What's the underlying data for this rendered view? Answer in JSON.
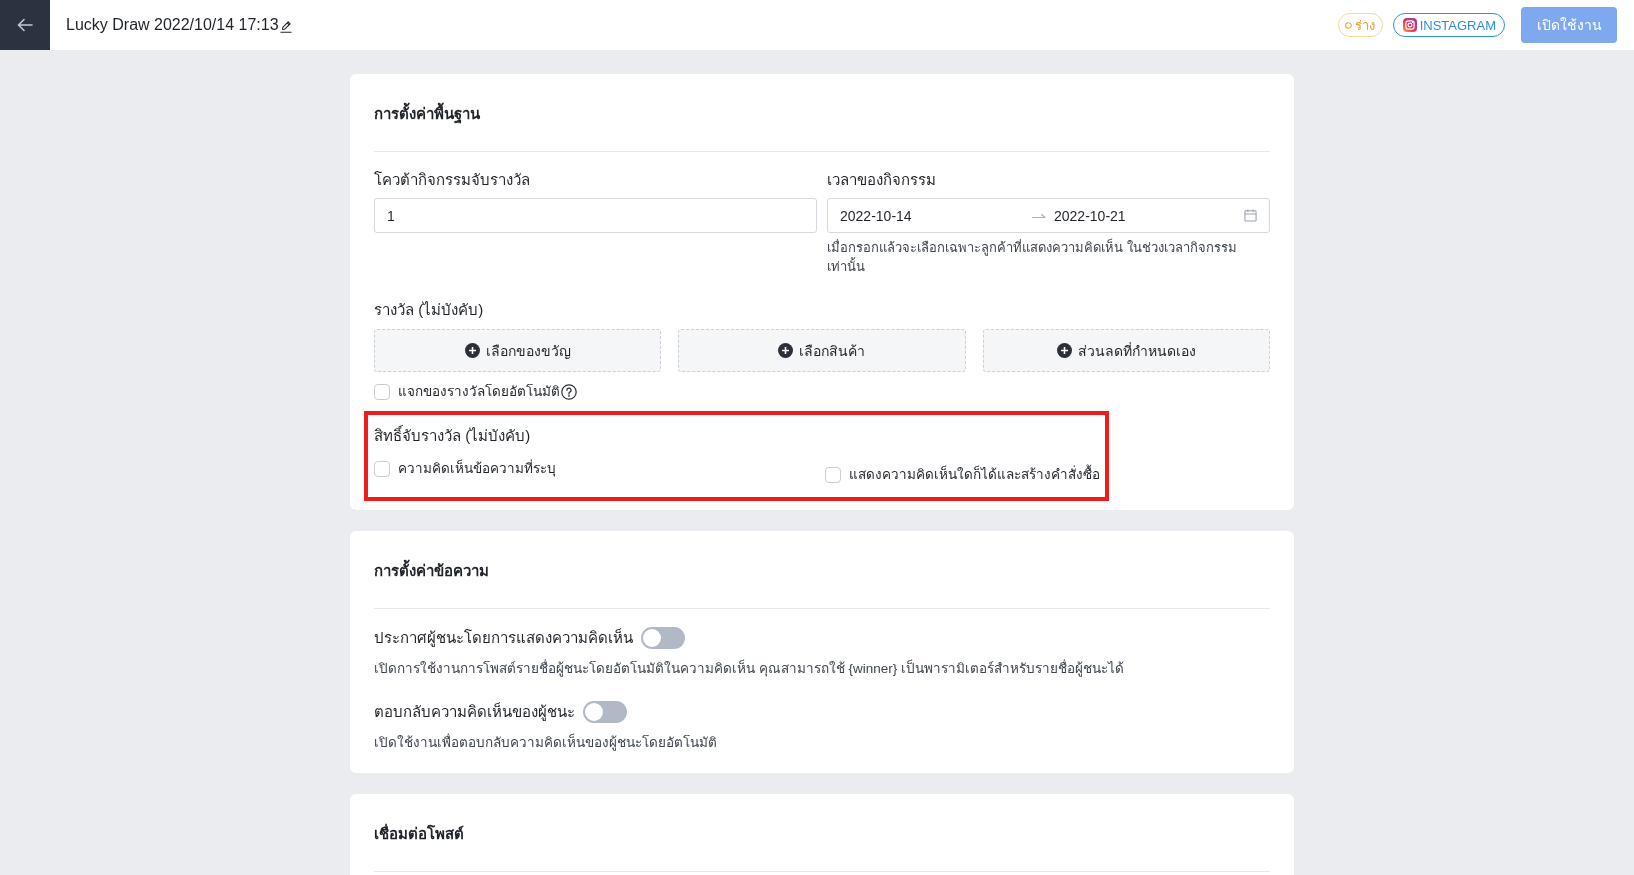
{
  "header": {
    "title": "Lucky Draw 2022/10/14 17:13",
    "status": "ร่าง",
    "platform": "INSTAGRAM",
    "enable_button": {
      "label": "เปิดใช้งาน",
      "disabled": true
    }
  },
  "basic_settings": {
    "title": "การตั้งค่าพื้นฐาน",
    "quota": {
      "label": "โควต้ากิจกรรมจับรางวัล",
      "value": "1"
    },
    "activity_time": {
      "label": "เวลาของกิจกรรม",
      "start": "2022-10-14",
      "end": "2022-10-21",
      "hint": "เมื่อกรอกแล้วจะเลือกเฉพาะลูกค้าที่แสดงความคิดเห็น ในช่วงเวลากิจกรรมเท่านั้น"
    },
    "prizes": {
      "label": "รางวัล (ไม่บังคับ)",
      "options": [
        "เลือกของขวัญ",
        "เลือกสินค้า",
        "ส่วนลดที่กำหนดเอง"
      ]
    },
    "auto_give": {
      "label": "แจกของรางวัลโดยอัตโนมัติ",
      "checked": false
    },
    "draw_rights": {
      "label": "สิทธิ์จับรางวัล (ไม่บังคับ)",
      "highlighted": true,
      "options": [
        {
          "label": "ความคิดเห็นข้อความที่ระบุ",
          "checked": false
        },
        {
          "label": "แสดงความคิดเห็นใดก็ได้และสร้างคำสั่งซื้อ",
          "checked": false
        }
      ]
    }
  },
  "message_settings": {
    "title": "การตั้งค่าข้อความ",
    "toggles": [
      {
        "label": "ประกาศผู้ชนะโดยการแสดงความคิดเห็น",
        "on": false,
        "description": "เปิดการใช้งานการโพสต์รายชื่อผู้ชนะโดยอัตโนมัติในความคิดเห็น คุณสามารถใช้ {winner} เป็นพารามิเตอร์สำหรับรายชื่อผู้ชนะได้"
      },
      {
        "label": "ตอบกลับความคิดเห็นของผู้ชนะ",
        "on": false,
        "description": "เปิดใช้งานเพื่อตอบกลับความคิดเห็นของผู้ชนะโดยอัตโนมัติ"
      }
    ]
  },
  "post_link": {
    "title": "เชื่อมต่อโพสต์"
  }
}
